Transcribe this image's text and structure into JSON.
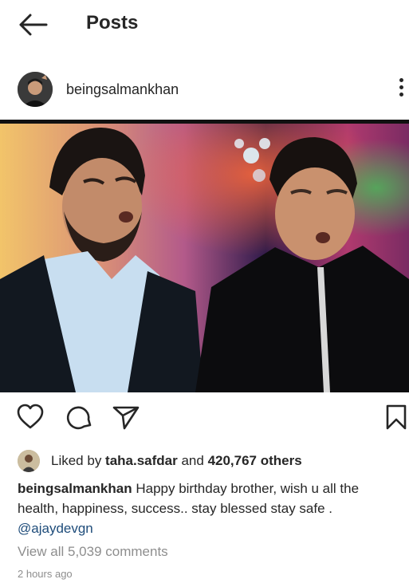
{
  "header": {
    "title": "Posts",
    "back_icon": "arrow-left-icon"
  },
  "post": {
    "username": "beingsalmankhan",
    "image_description": "",
    "likes": {
      "prefix": "Liked by ",
      "first_liker": "taha.safdar",
      "middle": " and ",
      "others": "420,767 others"
    },
    "caption": {
      "username": "beingsalmankhan",
      "text": " Happy  birthday brother, wish u all the health, happiness, success.. stay blessed stay safe . ",
      "mention": "@ajaydevgn"
    },
    "view_comments": "View all 5,039 comments",
    "timestamp": "2 hours ago"
  },
  "colors": {
    "text": "#262626",
    "muted": "#8e8e8e",
    "mention": "#1e4c7a"
  }
}
